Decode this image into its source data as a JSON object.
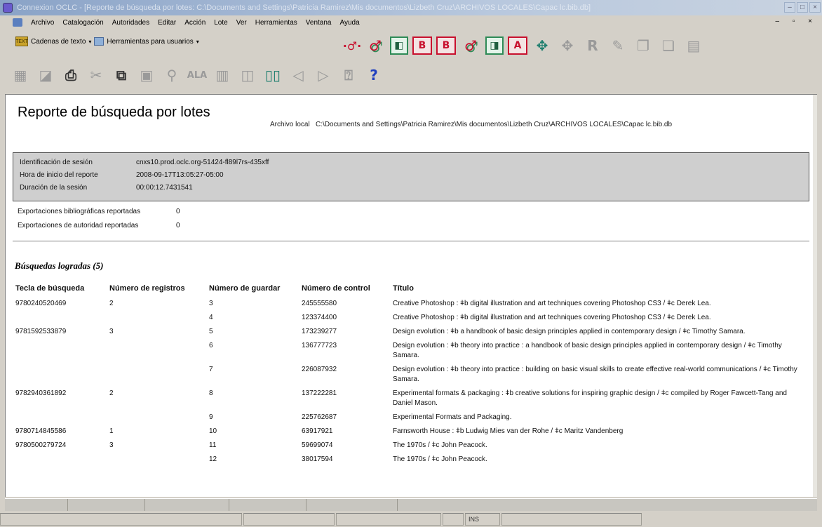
{
  "window": {
    "title": "Connexion OCLC - [Reporte de búsqueda por lotes: C:\\Documents and Settings\\Patricia Ramirez\\Mis documentos\\Lizbeth Cruz\\ARCHIVOS LOCALES\\Capac lc.bib.db]",
    "controls": [
      "–",
      "□",
      "×"
    ]
  },
  "menubar": {
    "items": [
      "Archivo",
      "Catalogación",
      "Autoridades",
      "Editar",
      "Acción",
      "Lote",
      "Ver",
      "Herramientas",
      "Ventana",
      "Ayuda"
    ],
    "mdi_controls": "– ▫ ×"
  },
  "toolbar1": {
    "text_strings_label": "Cadenas de texto",
    "user_tools_label": "Herramientas para usuarios",
    "text_icon_label": "TEXT"
  },
  "report": {
    "title": "Reporte de búsqueda por lotes",
    "local_file_label": "Archivo local",
    "local_file_path": "C:\\Documents and Settings\\Patricia Ramirez\\Mis documentos\\Lizbeth Cruz\\ARCHIVOS LOCALES\\Capac lc.bib.db",
    "session": [
      {
        "label": "Identificación de sesión",
        "value": "cnxs10.prod.oclc.org-51424-fl89l7rs-435xff"
      },
      {
        "label": "Hora de inicio del reporte",
        "value": "2008-09-17T13:05:27-05:00"
      },
      {
        "label": "Duración de la sesión",
        "value": "00:00:12.7431541"
      }
    ],
    "counts": [
      {
        "label": "Exportaciones bibliográficas reportadas",
        "value": "0"
      },
      {
        "label": "Exportaciones de autoridad reportadas",
        "value": "0"
      }
    ],
    "section_title": "Búsquedas logradas (5)",
    "columns": [
      "Tecla de búsqueda",
      "Número de registros",
      "Número de guardar",
      "Número de control",
      "Título"
    ],
    "rows": [
      {
        "key": "9780240520469",
        "records": "2",
        "save": "3",
        "control": "245555580",
        "title": "Creative Photoshop : ǂb digital illustration and art techniques covering Photoshop CS3 / ǂc Derek Lea."
      },
      {
        "key": "",
        "records": "",
        "save": "4",
        "control": "123374400",
        "title": "Creative Photoshop : ǂb digital illustration and art techniques covering Photoshop CS3 / ǂc Derek Lea."
      },
      {
        "key": "9781592533879",
        "records": "3",
        "save": "5",
        "control": "173239277",
        "title": "Design evolution : ǂb a handbook of basic design principles applied in contemporary design / ǂc Timothy Samara."
      },
      {
        "key": "",
        "records": "",
        "save": "6",
        "control": "136777723",
        "title": "Design evolution : ǂb theory into practice : a handbook of basic design principles applied in contemporary design / ǂc Timothy Samara."
      },
      {
        "key": "",
        "records": "",
        "save": "7",
        "control": "226087932",
        "title": "Design evolution : ǂb theory into practice : building on basic visual skills to create effective real-world communications / ǂc Timothy Samara."
      },
      {
        "key": "9782940361892",
        "records": "2",
        "save": "8",
        "control": "137222281",
        "title": "Experimental formats & packaging : ǂb creative solutions for inspiring graphic design / ǂc compiled by Roger Fawcett-Tang and Daniel Mason."
      },
      {
        "key": "",
        "records": "",
        "save": "9",
        "control": "225762687",
        "title": "Experimental Formats and Packaging."
      },
      {
        "key": "9780714845586",
        "records": "1",
        "save": "10",
        "control": "63917921",
        "title": "Farnsworth House : ǂb Ludwig Mies van der Rohe / ǂc Maritz Vandenberg"
      },
      {
        "key": "9780500279724",
        "records": "3",
        "save": "11",
        "control": "59699074",
        "title": "The 1970s / ǂc John Peacock."
      },
      {
        "key": "",
        "records": "",
        "save": "12",
        "control": "38017594",
        "title": "The 1970s / ǂc John Peacock."
      }
    ]
  },
  "statusbar": {
    "ins": "INS"
  },
  "colors": {
    "session_box_bg": "#cfcfcf",
    "chrome_bg": "#d4d0c8",
    "accent_red": "#c8102e",
    "accent_blue": "#1f3fbf"
  }
}
